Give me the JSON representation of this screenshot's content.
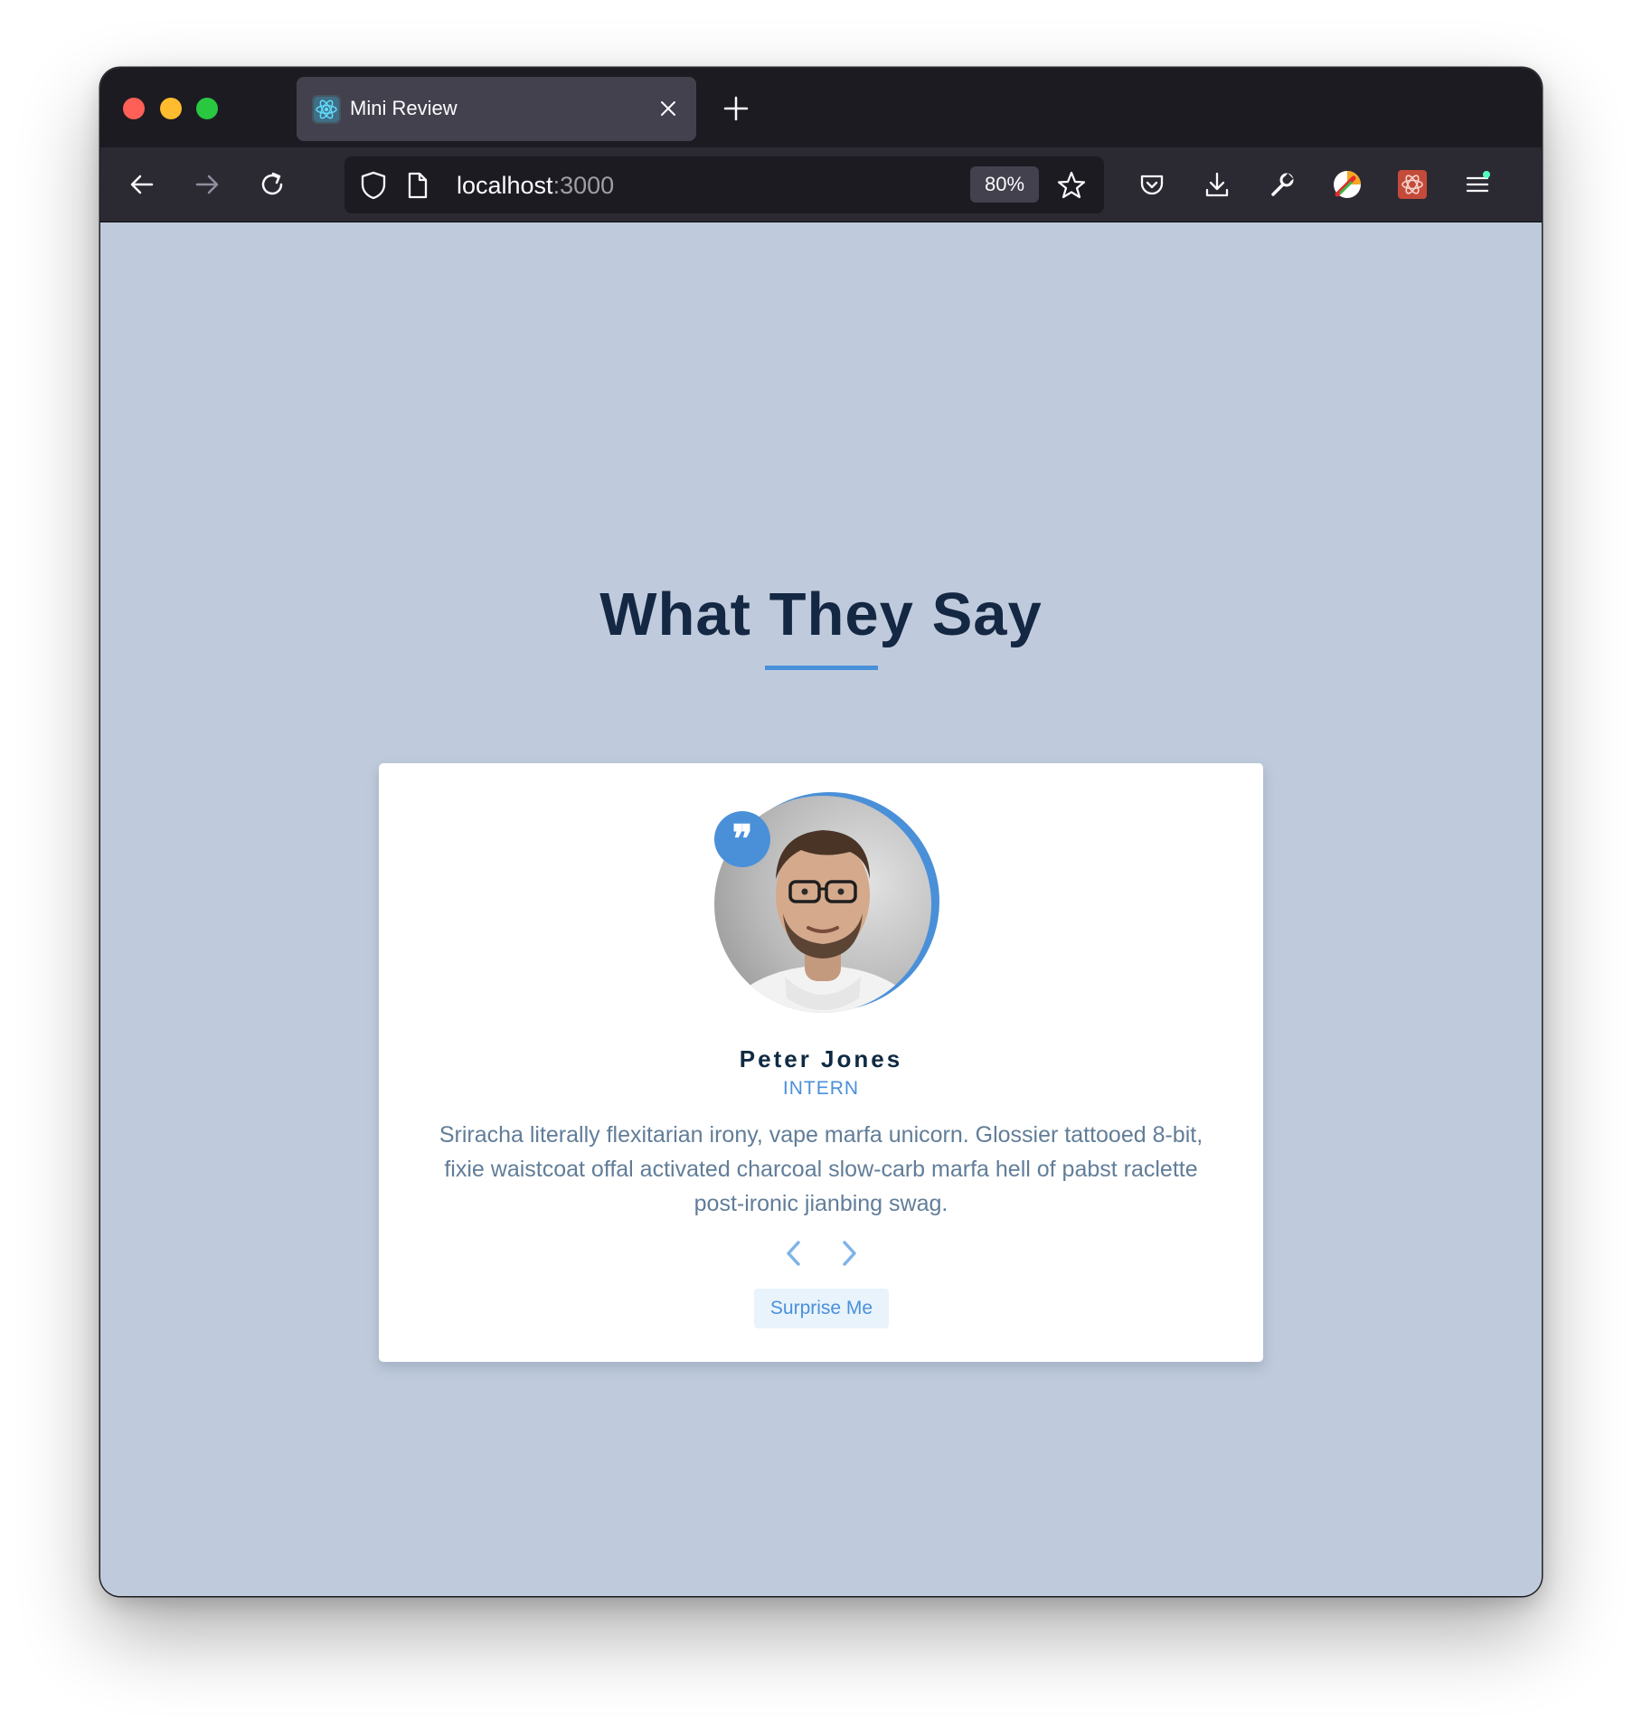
{
  "browser": {
    "tab": {
      "title": "Mini Review",
      "icon": "react-icon"
    },
    "url": {
      "host": "localhost",
      "port": ":3000"
    },
    "zoom": "80%",
    "toolbar_icons": [
      "back-arrow-icon",
      "forward-arrow-icon",
      "reload-icon",
      "shield-icon",
      "page-icon",
      "star-icon",
      "pocket-icon",
      "download-icon",
      "wrench-icon",
      "colorful-extension-icon",
      "react-devtools-icon",
      "menu-icon"
    ]
  },
  "page": {
    "heading": "What They Say",
    "accent_color": "#4a90d9",
    "review": {
      "name": "Peter Jones",
      "job": "INTERN",
      "text": "Sriracha literally flexitarian irony, vape marfa unicorn. Glossier tattooed 8-bit, fixie waistcoat offal activated charcoal slow-carb marfa hell of pabst raclette post-ironic jianbing swag.",
      "quote_symbol": "❞"
    },
    "surprise_label": "Surprise Me"
  }
}
